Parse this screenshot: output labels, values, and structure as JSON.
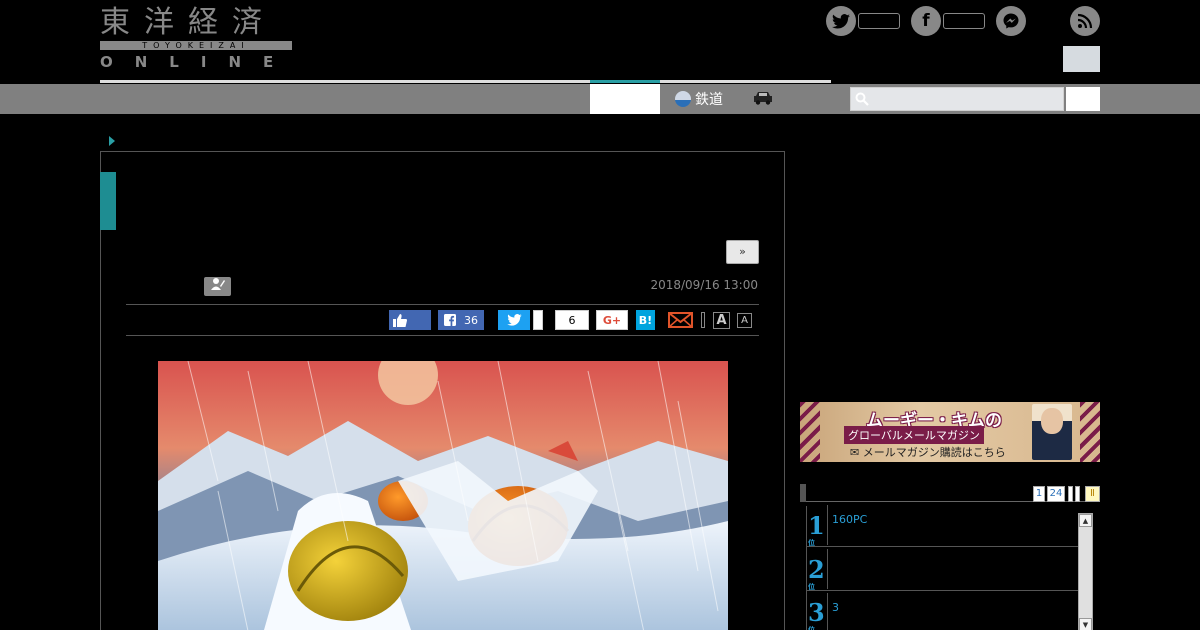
{
  "site": {
    "logo_kanji": "東洋経済",
    "logo_romaji": "TOYOKEIZAI",
    "logo_online": "ONLINE"
  },
  "nav": {
    "train_label": "鉄道",
    "search_placeholder": ""
  },
  "article": {
    "next_label": "»",
    "date": "2018/09/16 13:00",
    "share": {
      "fb_count": "36",
      "pocket_count": "6",
      "gplus_label": "G+",
      "hatena_label": "B!",
      "font_large": "A",
      "font_small": "A"
    }
  },
  "banner": {
    "title": "ムーギー・キムの",
    "subtitle": "グローバルメールマガジン",
    "cta": "メールマガジン購読はこちら"
  },
  "ranking": {
    "tabs": [
      "1",
      "24"
    ],
    "items": [
      {
        "rank": "1",
        "suffix": "位",
        "title": "160PC"
      },
      {
        "rank": "2",
        "suffix": "位",
        "title": ""
      },
      {
        "rank": "3",
        "suffix": "位",
        "title": "3"
      }
    ]
  },
  "colors": {
    "accent_teal": "#2a9fa5",
    "nav_gray": "#808080",
    "facebook": "#4267b2",
    "twitter": "#1da1f2",
    "rank_blue": "#2a9fd6"
  }
}
